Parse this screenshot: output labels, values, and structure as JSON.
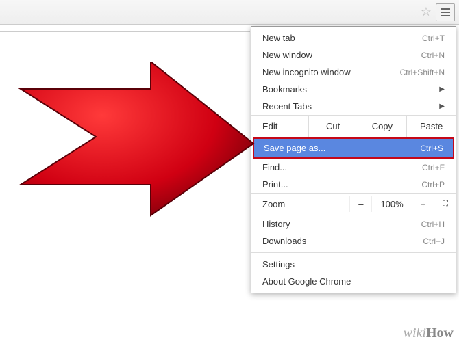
{
  "menu": {
    "new_tab": {
      "label": "New tab",
      "shortcut": "Ctrl+T"
    },
    "new_window": {
      "label": "New window",
      "shortcut": "Ctrl+N"
    },
    "incognito": {
      "label": "New incognito window",
      "shortcut": "Ctrl+Shift+N"
    },
    "bookmarks": {
      "label": "Bookmarks"
    },
    "recent_tabs": {
      "label": "Recent Tabs"
    },
    "edit": {
      "label": "Edit",
      "cut": "Cut",
      "copy": "Copy",
      "paste": "Paste"
    },
    "save_as": {
      "label": "Save page as...",
      "shortcut": "Ctrl+S"
    },
    "find": {
      "label": "Find...",
      "shortcut": "Ctrl+F"
    },
    "print": {
      "label": "Print...",
      "shortcut": "Ctrl+P"
    },
    "zoom": {
      "label": "Zoom",
      "minus": "–",
      "value": "100%",
      "plus": "+",
      "fullscreen": "⛶"
    },
    "history": {
      "label": "History",
      "shortcut": "Ctrl+H"
    },
    "downloads": {
      "label": "Downloads",
      "shortcut": "Ctrl+J"
    },
    "settings": {
      "label": "Settings"
    },
    "about": {
      "label": "About Google Chrome"
    }
  },
  "watermark": {
    "wiki": "wiki",
    "how": "How"
  }
}
